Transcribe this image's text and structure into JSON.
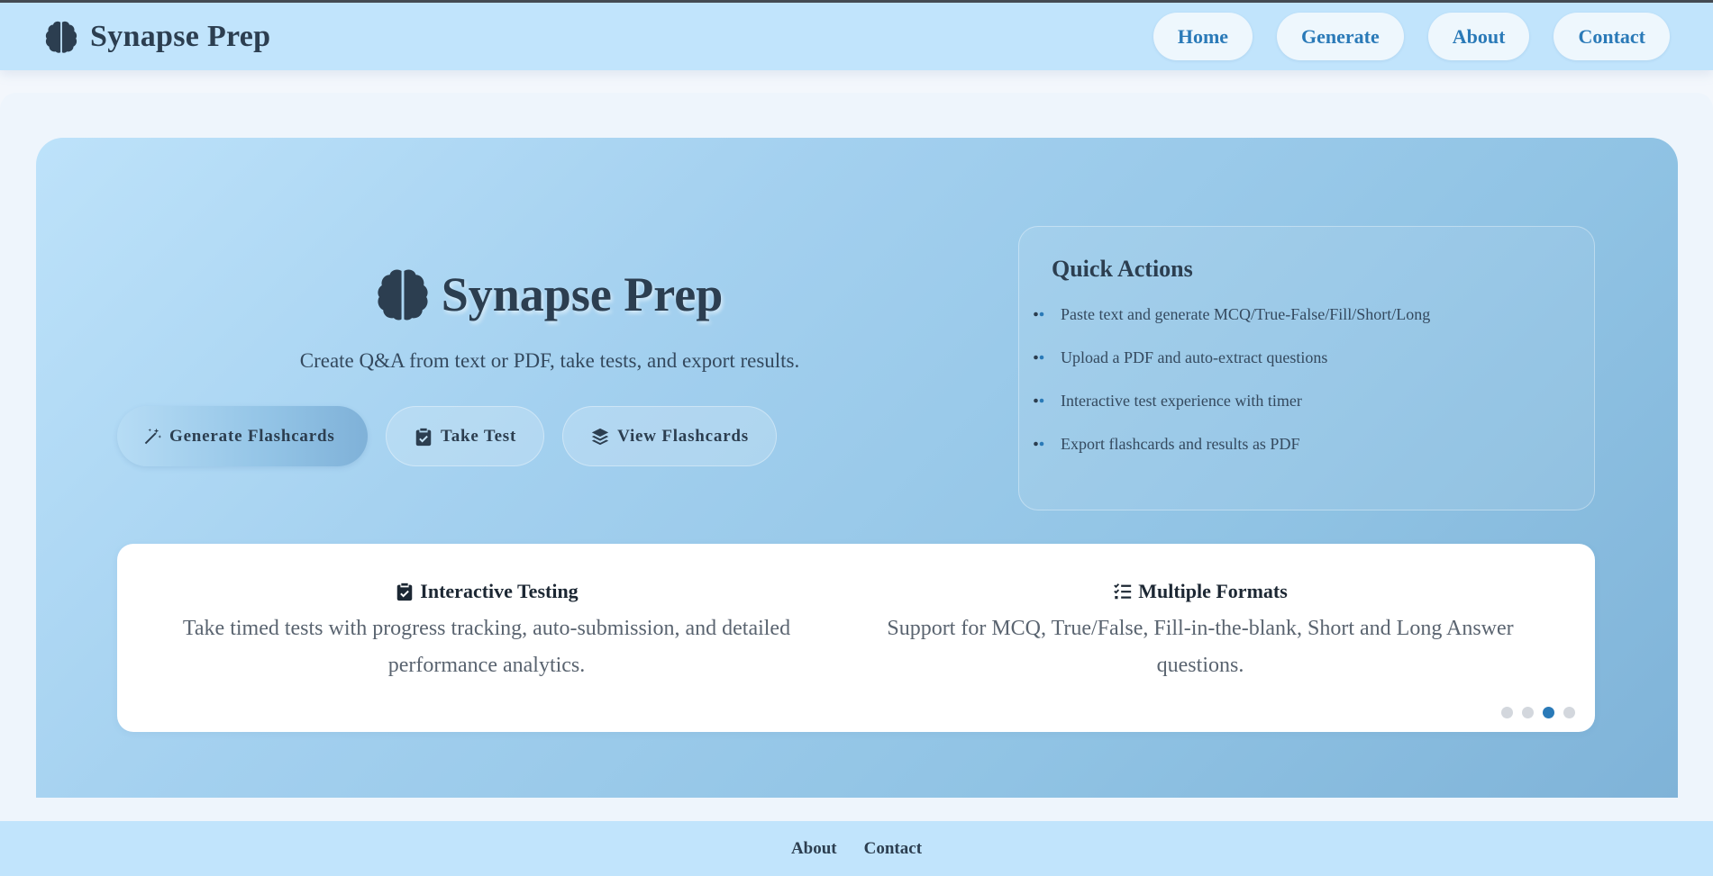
{
  "header": {
    "brand": "Synapse Prep",
    "brand_icon": "brain-icon",
    "nav": [
      {
        "label": "Home"
      },
      {
        "label": "Generate"
      },
      {
        "label": "About"
      },
      {
        "label": "Contact"
      }
    ]
  },
  "hero": {
    "title": "Synapse Prep",
    "title_icon": "brain-icon",
    "subtitle": "Create Q&A from text or PDF, take tests, and export results.",
    "buttons": [
      {
        "label": "Generate Flashcards",
        "icon": "magic-wand-icon"
      },
      {
        "label": "Take Test",
        "icon": "clipboard-check-icon"
      },
      {
        "label": "View Flashcards",
        "icon": "layers-icon"
      }
    ]
  },
  "quick_actions": {
    "title": "Quick Actions",
    "items": [
      "Paste text and generate MCQ/True-False/Fill/Short/Long",
      "Upload a PDF and auto-extract questions",
      "Interactive test experience with timer",
      "Export flashcards and results as PDF"
    ]
  },
  "features": [
    {
      "title": "Interactive Testing",
      "icon": "clipboard-check-icon",
      "description": "Take timed tests with progress tracking, auto-submission, and detailed performance analytics."
    },
    {
      "title": "Multiple Formats",
      "icon": "list-check-icon",
      "description": "Support for MCQ, True/False, Fill-in-the-blank, Short and Long Answer questions."
    }
  ],
  "carousel": {
    "total": 4,
    "active_index": 3
  },
  "footer": {
    "links": [
      "About",
      "Contact"
    ]
  },
  "colors": {
    "nav_bg": "#c1e4fc",
    "accent": "#2a7ab8",
    "text_dark": "#2c3e50",
    "hero_gradient_start": "#bde2fa",
    "hero_gradient_end": "#7fb3d8"
  }
}
